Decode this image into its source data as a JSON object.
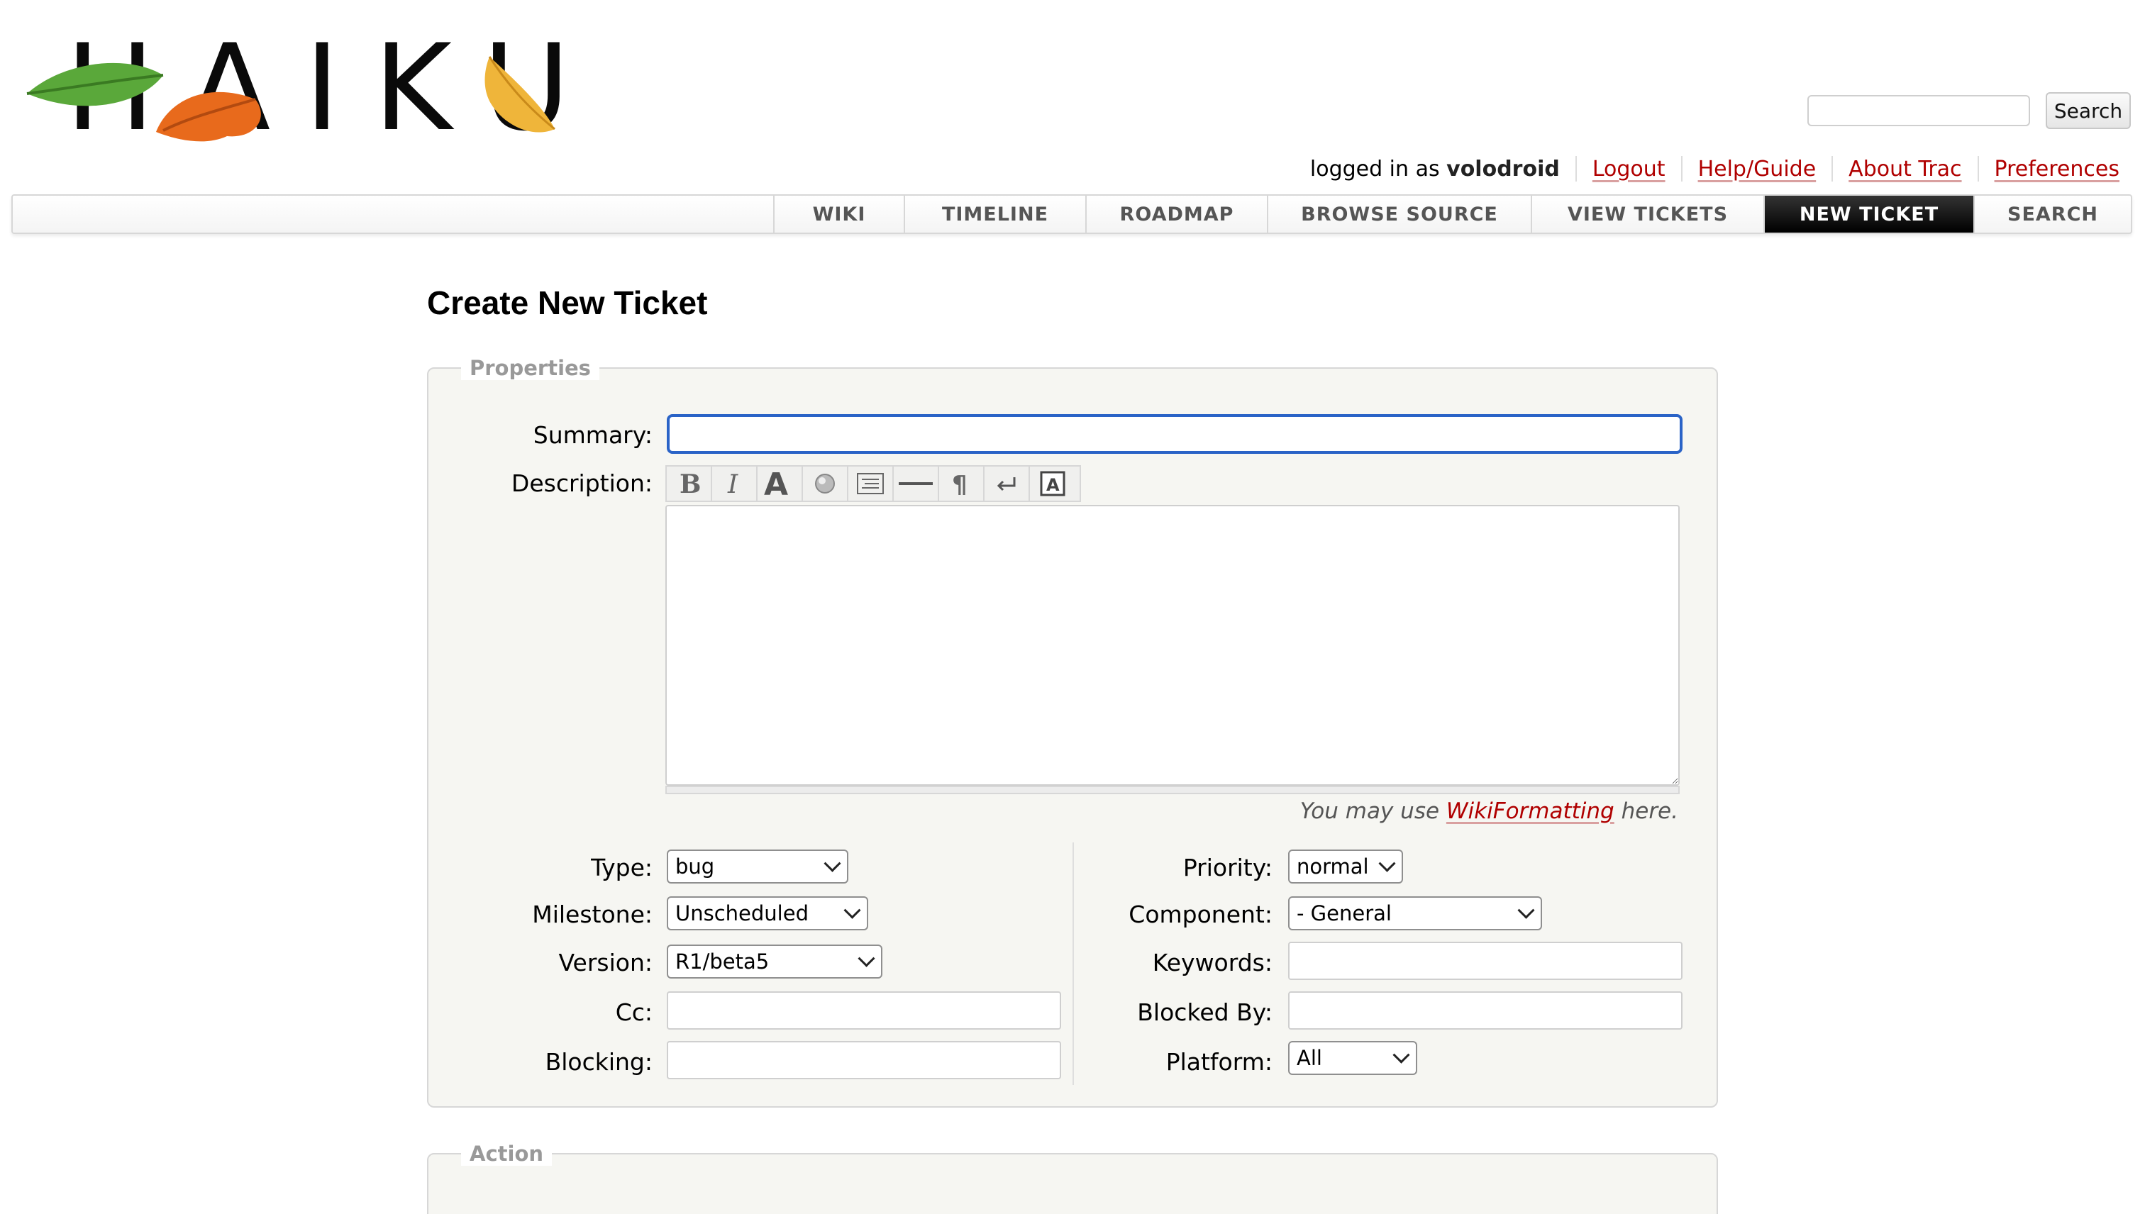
{
  "header": {
    "logo_text": "HAIKU",
    "search": {
      "placeholder": "",
      "button_label": "Search"
    },
    "metanav": {
      "logged_in_prefix": "logged in as",
      "username": "volodroid",
      "links": [
        "Logout",
        "Help/Guide",
        "About Trac",
        "Preferences"
      ]
    }
  },
  "mainnav": {
    "tabs": [
      "WIKI",
      "TIMELINE",
      "ROADMAP",
      "BROWSE SOURCE",
      "VIEW TICKETS",
      "NEW TICKET",
      "SEARCH"
    ],
    "active": "NEW TICKET"
  },
  "page": {
    "title": "Create New Ticket"
  },
  "properties": {
    "legend": "Properties",
    "summary_label": "Summary:",
    "summary_value": "",
    "description_label": "Description:",
    "description_value": "",
    "toolbar_icons": [
      "bold-icon",
      "italic-icon",
      "heading-icon",
      "link-icon",
      "code-block-icon",
      "horizontal-rule-icon",
      "paragraph-icon",
      "line-break-icon",
      "image-icon"
    ],
    "wiki_hint_prefix": "You may use",
    "wiki_hint_link": "WikiFormatting",
    "wiki_hint_suffix": "here.",
    "left_fields": {
      "type": {
        "label": "Type:",
        "value": "bug"
      },
      "milestone": {
        "label": "Milestone:",
        "value": "Unscheduled"
      },
      "version": {
        "label": "Version:",
        "value": "R1/beta5"
      },
      "cc": {
        "label": "Cc:",
        "value": ""
      },
      "blocking": {
        "label": "Blocking:",
        "value": ""
      }
    },
    "right_fields": {
      "priority": {
        "label": "Priority:",
        "value": "normal"
      },
      "component": {
        "label": "Component:",
        "value": "- General"
      },
      "keywords": {
        "label": "Keywords:",
        "value": ""
      },
      "blocked_by": {
        "label": "Blocked By:",
        "value": ""
      },
      "platform": {
        "label": "Platform:",
        "value": "All"
      }
    }
  },
  "action": {
    "legend": "Action"
  },
  "colors": {
    "link": "#b00000",
    "active_tab_bg": "#000000",
    "focus_border": "#2a63c7",
    "fieldset_bg": "#f6f6f2"
  }
}
